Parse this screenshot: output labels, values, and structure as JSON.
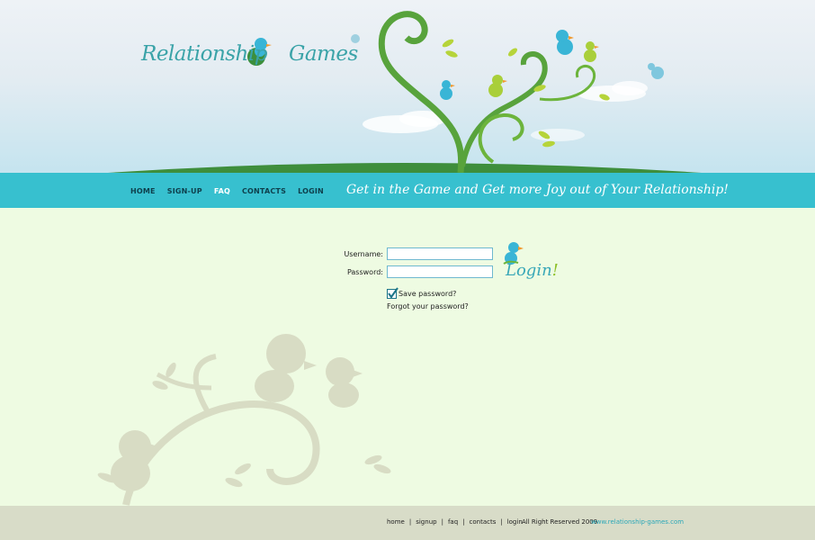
{
  "logo": {
    "word1": "Relationship",
    "word2": "Games"
  },
  "nav": {
    "items": [
      {
        "label": "HOME",
        "active": false
      },
      {
        "label": "SIGN-UP",
        "active": false
      },
      {
        "label": "FAQ",
        "active": true
      },
      {
        "label": "CONTACTS",
        "active": false
      },
      {
        "label": "LOGIN",
        "active": false
      }
    ],
    "tagline": "Get in the Game and Get more Joy out of Your Relationship!"
  },
  "login": {
    "username_label": "Username:",
    "password_label": "Password:",
    "username_value": "",
    "password_value": "",
    "save_password_label": "Save password?",
    "save_password_checked": true,
    "forgot_label": "Forgot your password?",
    "login_word": "Login",
    "login_exclaim": "!"
  },
  "footer": {
    "links": [
      "home",
      "signup",
      "faq",
      "contacts",
      "login"
    ],
    "copyright": "All Right Reserved 2009",
    "site": "www.relationship-games.com"
  },
  "colors": {
    "nav_bar": "#37c0cf",
    "content_bg": "#eefbe2",
    "footer_bg": "#d8dcc8",
    "accent_teal": "#3aa3a8",
    "accent_green": "#8fc12a"
  }
}
